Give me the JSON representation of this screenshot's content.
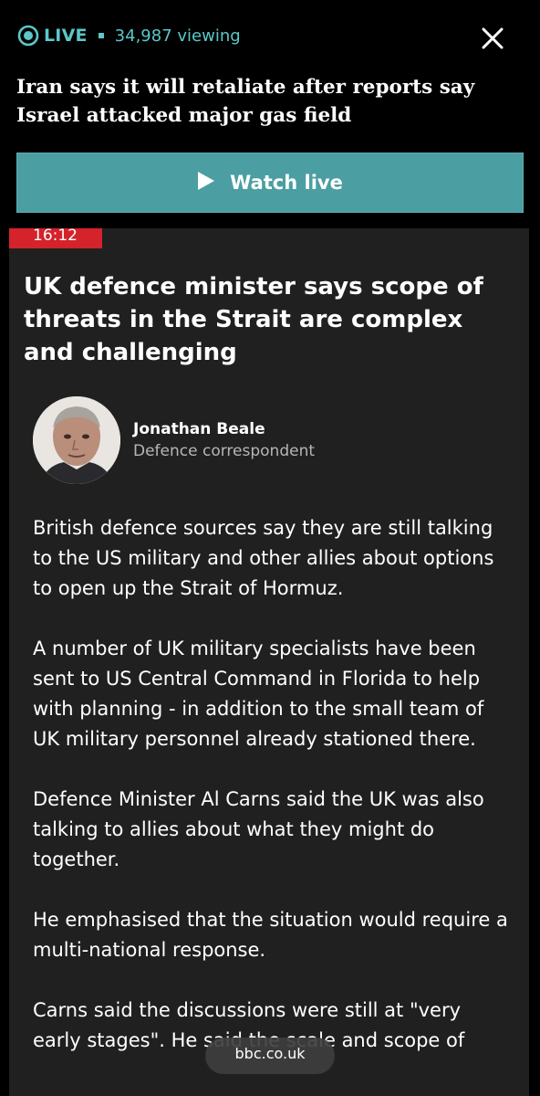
{
  "header": {
    "live_label": "LIVE",
    "viewing": "34,987 viewing",
    "headline": "Iran says it will retaliate after reports say Israel attacked major gas field",
    "watch_label": "Watch live",
    "accent": "#5cc7c9",
    "button_color": "#4b9ea2"
  },
  "icons": {
    "live": "live-broadcast-icon",
    "close": "close-icon",
    "play": "play-icon"
  },
  "post": {
    "time": "16:12",
    "time_color": "#d4232a",
    "title": "UK defence minister says scope of threats in the Strait are complex and challenging",
    "author_name": "Jonathan Beale",
    "author_role": "Defence correspondent",
    "paragraphs": [
      "British defence sources say they are still talking to the US military and other allies about options to open up the Strait of Hormuz.",
      "A number of UK military specialists have been sent to US Central Command in Florida to help with planning - in addition to the small team of UK military personnel already stationed there.",
      "Defence Minister Al Carns said the UK was also talking to allies about what they might do together.",
      "He emphasised that the situation would require a multi-national response.",
      "Carns said the discussions were still at \"very early stages\". He said the scale and scope of"
    ]
  },
  "browser": {
    "url": "bbc.co.uk"
  }
}
